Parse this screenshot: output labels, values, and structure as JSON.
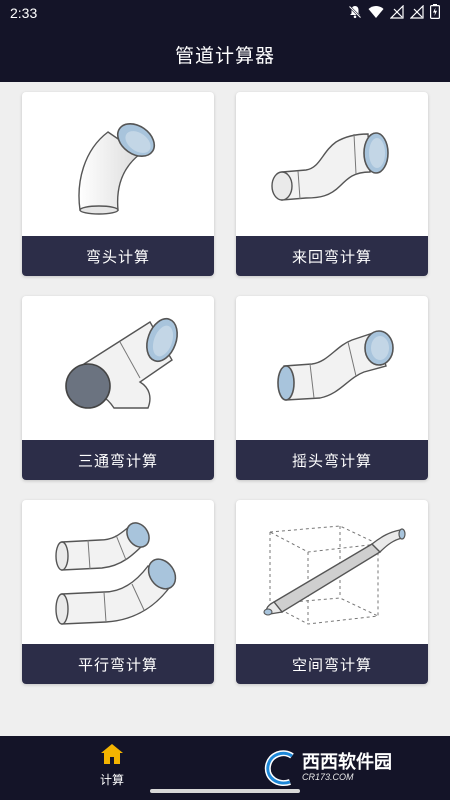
{
  "status": {
    "time": "2:33"
  },
  "header": {
    "title": "管道计算器"
  },
  "cards": [
    {
      "label": "弯头计算",
      "icon": "elbow-pipe-icon"
    },
    {
      "label": "来回弯计算",
      "icon": "offset-bend-pipe-icon"
    },
    {
      "label": "三通弯计算",
      "icon": "tee-pipe-icon"
    },
    {
      "label": "摇头弯计算",
      "icon": "rolling-offset-pipe-icon"
    },
    {
      "label": "平行弯计算",
      "icon": "parallel-bend-pipe-icon"
    },
    {
      "label": "空间弯计算",
      "icon": "spatial-bend-pipe-icon"
    }
  ],
  "bottom_nav": {
    "items": [
      {
        "label": "计算",
        "icon": "home-icon",
        "color": "#f4b400"
      }
    ]
  },
  "watermark": {
    "brand": "西西软件园",
    "site": "CR173.COM"
  },
  "colors": {
    "bar": "#141428",
    "card_label_bg": "#2c2d48",
    "pipe_fill": "#f4f4f4",
    "pipe_inner": "#a8c4dc",
    "pipe_dark": "#6b7380"
  }
}
